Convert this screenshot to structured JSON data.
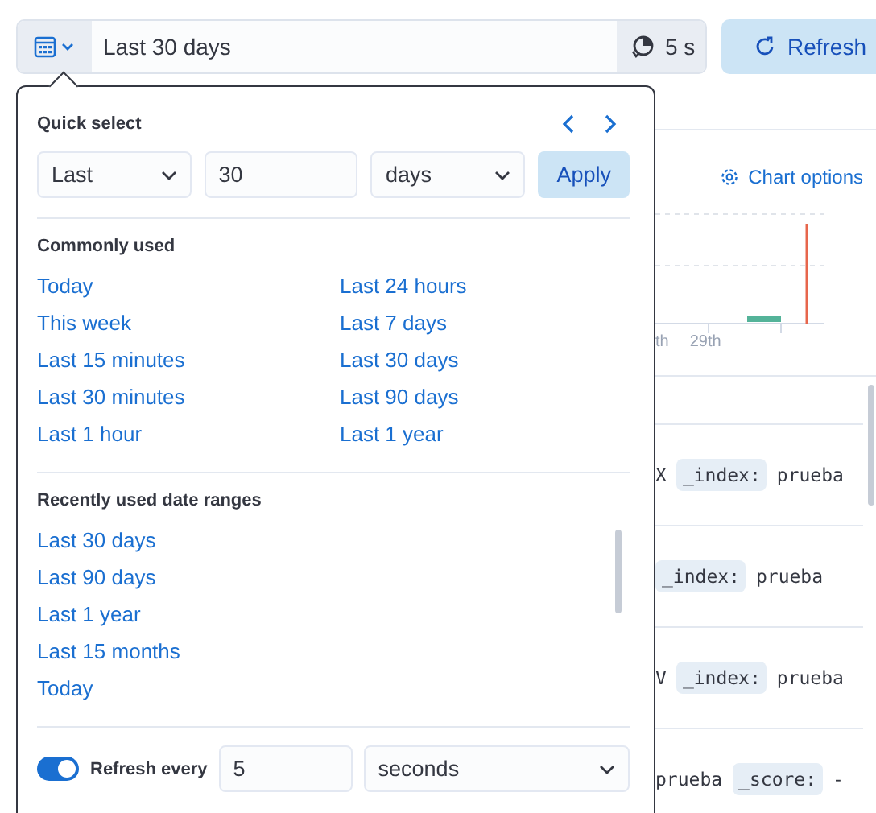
{
  "date_picker": {
    "value": "Last 30 days",
    "refresh_interval": "5 s"
  },
  "refresh_button": {
    "label": "Refresh"
  },
  "quick_select": {
    "title": "Quick select",
    "direction": "Last",
    "amount": "30",
    "unit": "days",
    "apply": "Apply"
  },
  "commonly_used": {
    "title": "Commonly used",
    "items": [
      "Today",
      "This week",
      "Last 15 minutes",
      "Last 30 minutes",
      "Last 1 hour",
      "Last 24 hours",
      "Last 7 days",
      "Last 30 days",
      "Last 90 days",
      "Last 1 year"
    ]
  },
  "recently_used": {
    "title": "Recently used date ranges",
    "items": [
      "Last 30 days",
      "Last 90 days",
      "Last 1 year",
      "Last 15 months",
      "Today"
    ]
  },
  "auto_refresh": {
    "on": true,
    "label": "Refresh every",
    "interval": "5",
    "unit": "seconds"
  },
  "background": {
    "chart_options": "Chart options",
    "axis_labels": [
      "th",
      "29th"
    ],
    "rows": [
      {
        "prefix": "X",
        "field": "_index:",
        "value": "prueba"
      },
      {
        "field": "_index:",
        "value": "prueba"
      },
      {
        "prefix": "V",
        "field": "_index:",
        "value": "prueba"
      },
      {
        "prefix": "prueba",
        "field": "_score:",
        "value": "-"
      }
    ]
  }
}
